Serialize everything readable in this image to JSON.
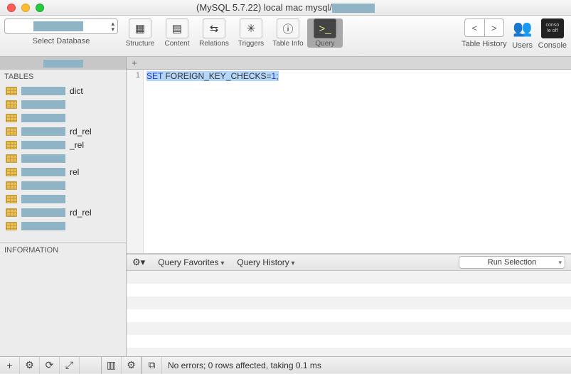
{
  "window": {
    "title_prefix": "(MySQL 5.7.22) local mac mysql/"
  },
  "toolbar": {
    "select_db_label": "Select Database",
    "items": [
      {
        "key": "structure",
        "label": "Structure",
        "glyph": "▦"
      },
      {
        "key": "content",
        "label": "Content",
        "glyph": "▤"
      },
      {
        "key": "relations",
        "label": "Relations",
        "glyph": "⇆"
      },
      {
        "key": "triggers",
        "label": "Triggers",
        "glyph": "✳"
      },
      {
        "key": "tableinfo",
        "label": "Table Info",
        "glyph": "ⓘ"
      },
      {
        "key": "query",
        "label": "Query",
        "glyph": ">_"
      }
    ],
    "active": "query",
    "history_label": "Table History",
    "users_label": "Users",
    "console_label": "Console"
  },
  "sidebar": {
    "tables_header": "TABLES",
    "info_header": "INFORMATION",
    "rows": [
      {
        "suffix": "dict"
      },
      {
        "suffix": ""
      },
      {
        "suffix": ""
      },
      {
        "suffix": "rd_rel"
      },
      {
        "suffix": "_rel"
      },
      {
        "suffix": ""
      },
      {
        "suffix": "rel"
      },
      {
        "suffix": ""
      },
      {
        "suffix": ""
      },
      {
        "suffix": "rd_rel"
      },
      {
        "suffix": ""
      }
    ]
  },
  "editor": {
    "line_no": "1",
    "keyword": "SET",
    "rest": " FOREIGN_KEY_CHECKS=",
    "value": "1",
    "semi": ";"
  },
  "querybar": {
    "favorites": "Query Favorites",
    "history": "Query History",
    "run": "Run Selection"
  },
  "status": {
    "message": "No errors; 0 rows affected, taking 0.1 ms"
  }
}
